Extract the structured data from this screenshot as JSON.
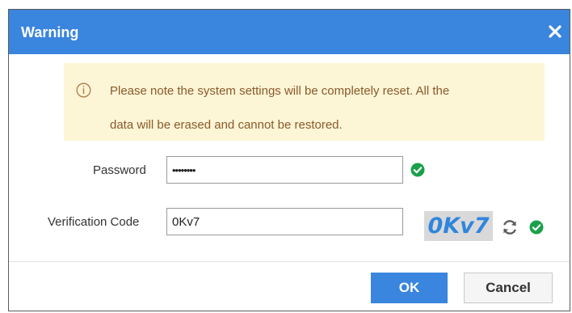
{
  "dialog": {
    "title": "Warning",
    "close_icon": "close-icon",
    "title_bar_color": "#3a85dd"
  },
  "notice": {
    "icon": "info-circle-icon",
    "line1": "Please note the system settings will be completely reset. All the",
    "line2": "data will be erased and cannot be restored.",
    "background": "#fcf5d6",
    "text_color": "#8a5a2b"
  },
  "form": {
    "password_label": "Password",
    "password_value": "••••••••",
    "password_status_icon": "check-circle-icon",
    "verification_label": "Verification Code",
    "verification_value": "0Kv7",
    "captcha_text": "0Kv7",
    "refresh_icon": "refresh-icon",
    "verification_status_icon": "check-circle-icon",
    "success_color": "#1aa04a"
  },
  "buttons": {
    "ok_label": "OK",
    "cancel_label": "Cancel"
  }
}
